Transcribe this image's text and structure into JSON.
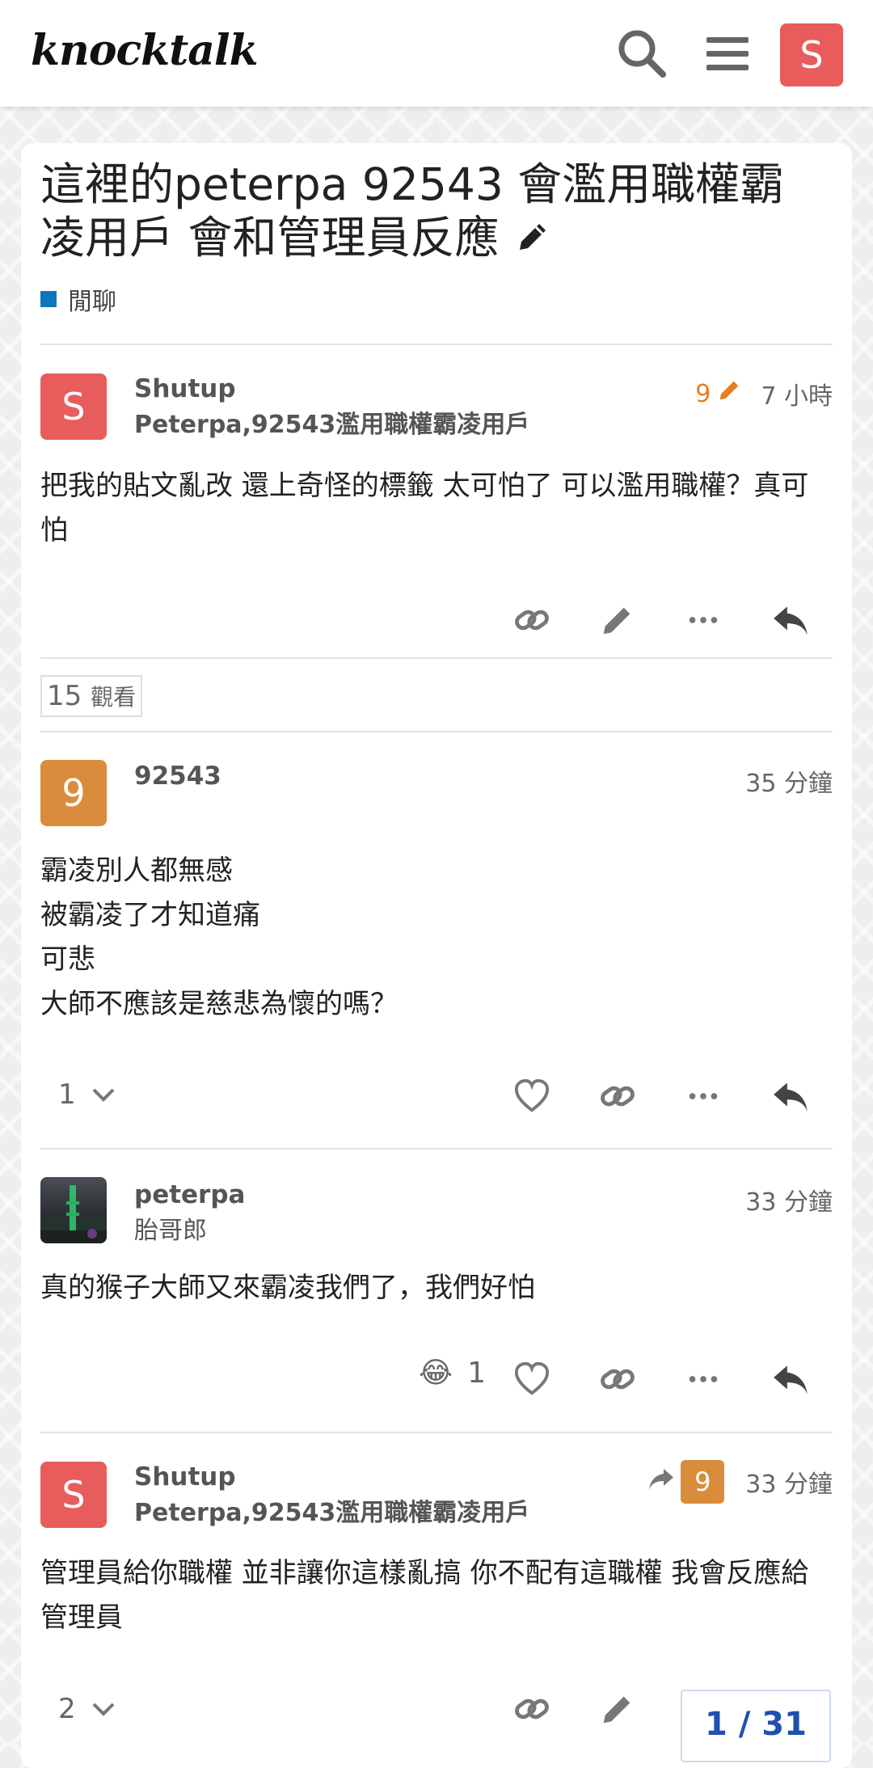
{
  "header": {
    "logo": "knocktalk",
    "avatar_letter": "S"
  },
  "topic": {
    "title": "這裡的peterpa 92543 會濫用職權霸凌用戶 會和管理員反應",
    "category": "閒聊",
    "category_color": "#0e76bd",
    "views": "15",
    "views_label": "觀看"
  },
  "posts": [
    {
      "avatar_letter": "S",
      "avatar_color": "#e85c5c",
      "username": "Shutup",
      "user_title": "Peterpa,92543濫用職權霸凌用戶",
      "edit_count": "9",
      "time": "7 小時",
      "lines": [
        "把我的貼文亂改 還上奇怪的標籤 太可怕了 可以濫用職權？真可怕"
      ]
    },
    {
      "avatar_letter": "9",
      "avatar_color": "#d98c3c",
      "username": "92543",
      "time": "35 分鐘",
      "lines": [
        "霸凌別人都無感",
        "被霸凌了才知道痛",
        "可悲",
        "大師不應該是慈悲為懷的嗎？"
      ],
      "like_count": "1"
    },
    {
      "username": "peterpa",
      "user_title": "胎哥郎",
      "time": "33 分鐘",
      "lines": [
        "真的猴子大師又來霸凌我們了，我們好怕"
      ],
      "reaction_emoji": "😂",
      "reaction_count": "1"
    },
    {
      "avatar_letter": "S",
      "avatar_color": "#e85c5c",
      "username": "Shutup",
      "user_title": "Peterpa,92543濫用職權霸凌用戶",
      "reply_to_letter": "9",
      "time": "33 分鐘",
      "lines": [
        "管理員給你職權 並非讓你這樣亂搞 你不配有這職權 我會反應給管理員"
      ],
      "like_count": "2"
    }
  ],
  "progress": "1 / 31"
}
